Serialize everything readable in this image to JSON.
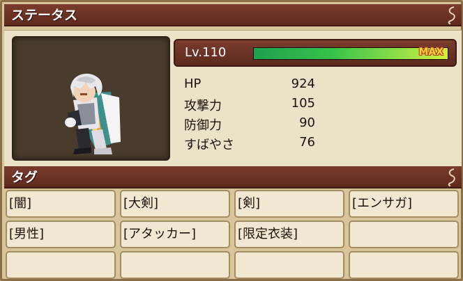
{
  "status_section": {
    "title": "ステータス",
    "level": {
      "label": "Lv.110",
      "max_label": "MAX",
      "exp_progress": 1.0
    },
    "stats": [
      {
        "name": "HP",
        "value": "924"
      },
      {
        "name": "攻撃力",
        "value": "105"
      },
      {
        "name": "防御力",
        "value": "90"
      },
      {
        "name": "すばやさ",
        "value": "76"
      }
    ]
  },
  "tags_section": {
    "title": "タグ",
    "tags": [
      "[闇]",
      "[大剣]",
      "[剣]",
      "[エンサガ]",
      "[男性]",
      "[アタッカー]",
      "[限定衣装]",
      "",
      "",
      "",
      "",
      ""
    ]
  },
  "colors": {
    "header": "#6b3224",
    "panel": "#ece2c8",
    "exp_bar": "#36c24a",
    "max_text": "#ffd23a"
  }
}
